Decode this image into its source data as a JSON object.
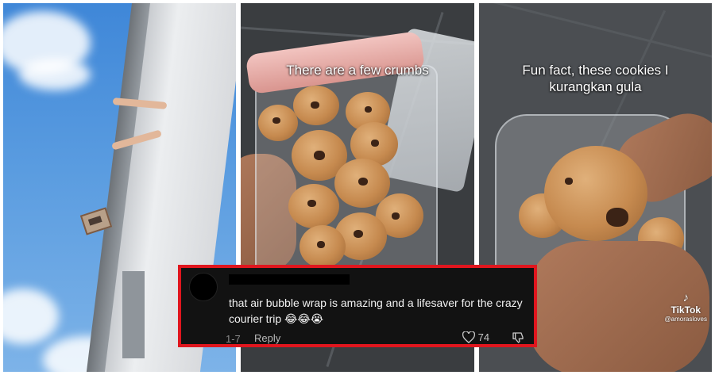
{
  "panels": {
    "middle": {
      "caption": "There are a few crumbs"
    },
    "right": {
      "caption_line1": "Fun fact, these cookies I",
      "caption_line2": "kurangkan gula",
      "watermark": {
        "brand": "TikTok",
        "handle": "@amorasloves",
        "icon": "tiktok-logo-icon"
      }
    }
  },
  "comment": {
    "text": "that air bubble wrap is amazing and a lifesaver for the crazy courier trip",
    "emoji": "😂😂😭",
    "timestamp": "1-7",
    "reply_label": "Reply",
    "like_count": "74",
    "border_color": "#e0161e"
  }
}
